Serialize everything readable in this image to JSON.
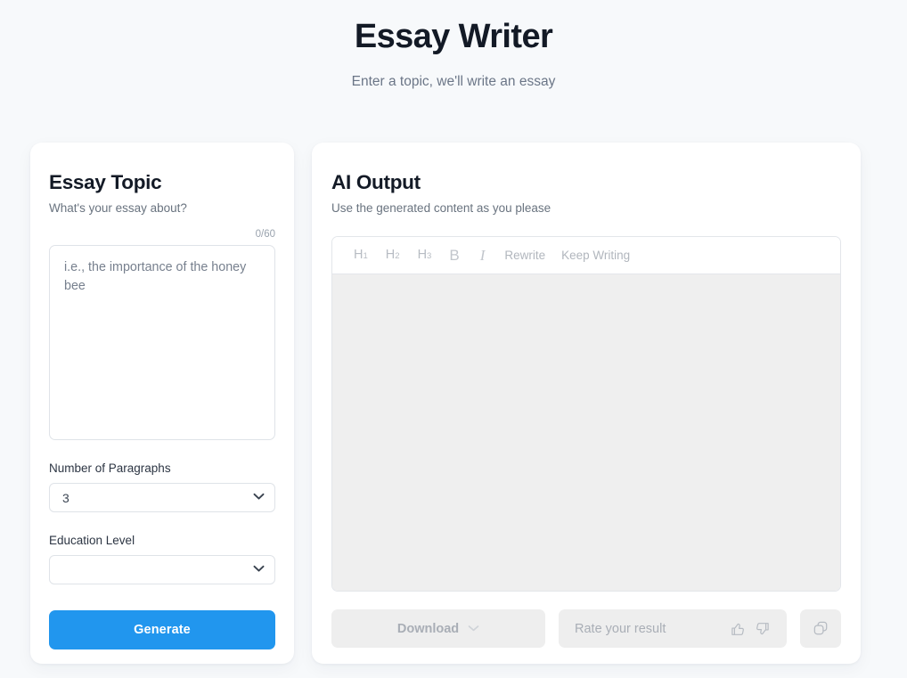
{
  "header": {
    "title": "Essay Writer",
    "subtitle": "Enter a topic, we'll write an essay"
  },
  "left_panel": {
    "title": "Essay Topic",
    "subtitle": "What's your essay about?",
    "counter": "0/60",
    "topic_value": "",
    "topic_placeholder": "i.e., the importance of the honey bee",
    "paragraphs_label": "Number of Paragraphs",
    "paragraphs_value": "3",
    "education_label": "Education Level",
    "education_value": "",
    "generate_label": "Generate"
  },
  "right_panel": {
    "title": "AI Output",
    "subtitle": "Use the generated content as you please",
    "toolbar": {
      "h1": "H",
      "h1_sub": "1",
      "h2": "H",
      "h2_sub": "2",
      "h3": "H",
      "h3_sub": "3",
      "bold": "B",
      "italic": "I",
      "rewrite": "Rewrite",
      "keep_writing": "Keep Writing"
    },
    "output_text": "",
    "download_label": "Download",
    "rate_label": "Rate your result"
  },
  "colors": {
    "accent": "#2196ee",
    "page_bg": "#f7f9fb",
    "card_bg": "#ffffff",
    "editor_bg": "#efefef",
    "heading": "#131a26",
    "muted": "#6b7687"
  }
}
